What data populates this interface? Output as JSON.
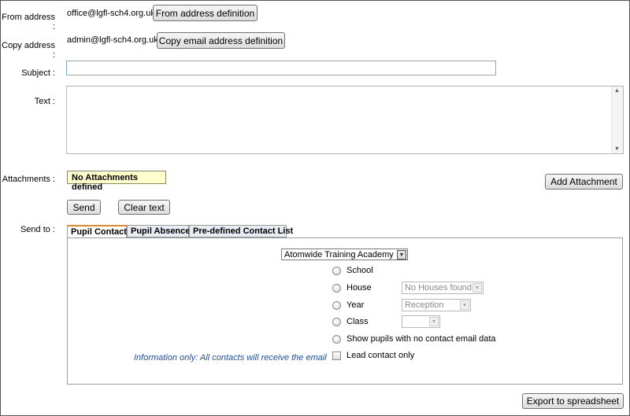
{
  "from": {
    "label": "From address :",
    "value": "office@lgfl-sch4.org.uk",
    "button": "From address definition"
  },
  "copy": {
    "label": "Copy address :",
    "value": "admin@lgfl-sch4.org.uk",
    "button": "Copy email address definition"
  },
  "subject": {
    "label": "Subject :",
    "value": ""
  },
  "text": {
    "label": "Text :",
    "value": ""
  },
  "attachments": {
    "label": "Attachments :",
    "status": "No Attachments defined",
    "add_button": "Add Attachment"
  },
  "actions": {
    "send": "Send",
    "clear": "Clear text"
  },
  "send_to": {
    "label": "Send to :",
    "tabs": [
      "Pupil Contacts",
      "Pupil Absence",
      "Pre-defined Contact List"
    ],
    "active_tab": 0
  },
  "pupil_contacts": {
    "school_select": "Atomwide Training Academy",
    "options": [
      {
        "label": "School"
      },
      {
        "label": "House",
        "select": "No Houses found"
      },
      {
        "label": "Year",
        "select": "Reception"
      },
      {
        "label": "Class",
        "select": ""
      },
      {
        "label": "Show pupils with no contact email data"
      }
    ],
    "info": "Information only: All contacts will receive the email",
    "lead_contact": "Lead contact only"
  },
  "export_button": "Export to spreadsheet",
  "colors": {
    "active_tab_accent": "#e88a2a",
    "info_text": "#1f4fa0",
    "attachment_badge": "#ffffcc"
  }
}
